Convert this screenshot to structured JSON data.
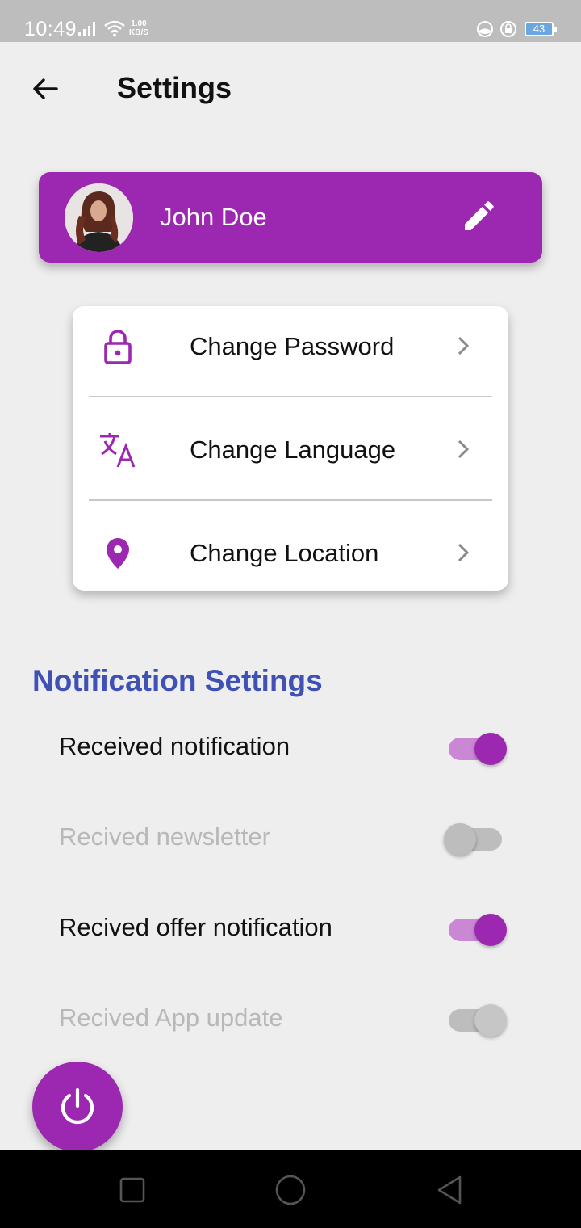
{
  "status_bar": {
    "time": "10:49",
    "speed_value": "1.00",
    "speed_unit": "KB/S",
    "battery": "43"
  },
  "header": {
    "title": "Settings",
    "back_icon": "arrow-left-icon"
  },
  "profile": {
    "name": "John Doe",
    "edit_icon": "pencil-icon",
    "avatar": "user-avatar"
  },
  "menu": {
    "items": [
      {
        "label": "Change Password",
        "icon": "lock-icon"
      },
      {
        "label": "Change Language",
        "icon": "translate-icon"
      },
      {
        "label": "Change Location",
        "icon": "location-pin-icon"
      }
    ]
  },
  "notifications": {
    "title": "Notification Settings",
    "items": [
      {
        "label": "Received notification",
        "checked": true,
        "enabled": true
      },
      {
        "label": "Recived newsletter",
        "checked": false,
        "enabled": false
      },
      {
        "label": "Recived offer notification",
        "checked": true,
        "enabled": true
      },
      {
        "label": "Recived App update",
        "checked": true,
        "enabled": false
      }
    ]
  },
  "fab": {
    "icon": "power-icon"
  },
  "colors": {
    "primary": "#9c27b0",
    "section_title": "#3f51b5",
    "background": "#eeeeee"
  }
}
